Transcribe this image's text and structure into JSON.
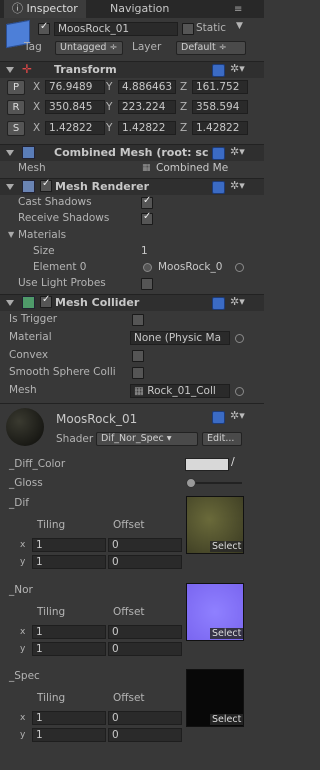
{
  "tabs": {
    "inspector": "Inspector",
    "navigation": "Navigation"
  },
  "object": {
    "name": "MoosRock_01",
    "static_label": "Static",
    "tag_label": "Tag",
    "tag_value": "Untagged",
    "layer_label": "Layer",
    "layer_value": "Default"
  },
  "transform": {
    "title": "Transform",
    "rows": [
      {
        "btn": "P",
        "x": "76.9489",
        "y": "4.886463",
        "z": "161.752"
      },
      {
        "btn": "R",
        "x": "350.845",
        "y": "223.224",
        "z": "358.594"
      },
      {
        "btn": "S",
        "x": "1.42822",
        "y": "1.42822",
        "z": "1.42822"
      }
    ],
    "axis": {
      "x": "X",
      "y": "Y",
      "z": "Z"
    }
  },
  "combined_mesh": {
    "title": "Combined Mesh (root: sc",
    "mesh_label": "Mesh",
    "mesh_value": "Combined Me"
  },
  "mesh_renderer": {
    "title": "Mesh Renderer",
    "cast_shadows": "Cast Shadows",
    "receive_shadows": "Receive Shadows",
    "materials": "Materials",
    "size_label": "Size",
    "size_value": "1",
    "element_label": "Element 0",
    "element_value": "MoosRock_0",
    "light_probes": "Use Light Probes"
  },
  "mesh_collider": {
    "title": "Mesh Collider",
    "is_trigger": "Is Trigger",
    "material_label": "Material",
    "material_value": "None (Physic Ma",
    "convex": "Convex",
    "smooth": "Smooth Sphere Colli",
    "mesh_label": "Mesh",
    "mesh_value": "Rock_01_Coll"
  },
  "material": {
    "name": "MoosRock_01",
    "shader_label": "Shader",
    "shader_value": "Dif_Nor_Spec",
    "edit_label": "Edit...",
    "diff_color": "_Diff_Color",
    "gloss": "_Gloss",
    "colors": {
      "diff": "#d8d8d8",
      "dif_tex": "#3a3a22",
      "nor_tex": "#7a66f0",
      "spec_tex": "#080808"
    },
    "textures": [
      {
        "name": "_Dif",
        "tiling": "Tiling",
        "offset": "Offset",
        "x_label": "x",
        "y_label": "y",
        "tx": "1",
        "ty": "1",
        "ox": "0",
        "oy": "0",
        "select": "Select"
      },
      {
        "name": "_Nor",
        "tiling": "Tiling",
        "offset": "Offset",
        "x_label": "x",
        "y_label": "y",
        "tx": "1",
        "ty": "1",
        "ox": "0",
        "oy": "0",
        "select": "Select"
      },
      {
        "name": "_Spec",
        "tiling": "Tiling",
        "offset": "Offset",
        "x_label": "x",
        "y_label": "y",
        "tx": "1",
        "ty": "1",
        "ox": "0",
        "oy": "0",
        "select": "Select"
      }
    ]
  }
}
